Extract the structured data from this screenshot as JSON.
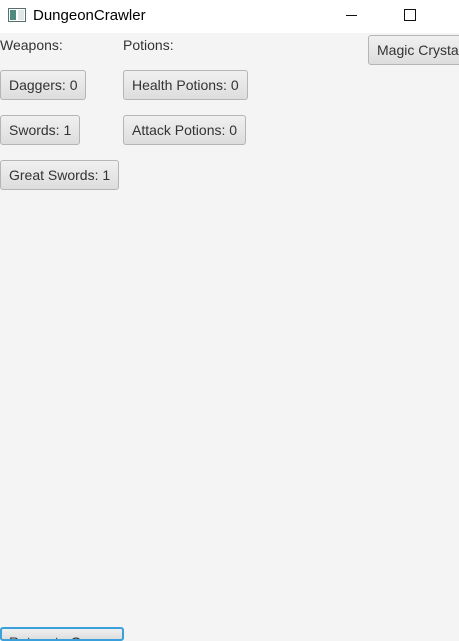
{
  "window": {
    "title": "DungeonCrawler",
    "icon": "app-window-icon"
  },
  "inventory": {
    "weapons_label": "Weapons:",
    "potions_label": "Potions:",
    "weapons": [
      {
        "label": "Daggers: 0"
      },
      {
        "label": "Swords: 1"
      },
      {
        "label": "Great Swords: 1"
      }
    ],
    "potions": [
      {
        "label": "Health Potions: 0"
      },
      {
        "label": "Attack Potions: 0"
      }
    ],
    "magic_crystal_label": "Magic Crystal"
  },
  "footer": {
    "return_label": "Return to Game"
  },
  "colors": {
    "background": "#f4f4f4",
    "focus_ring": "#3aa0dc"
  }
}
